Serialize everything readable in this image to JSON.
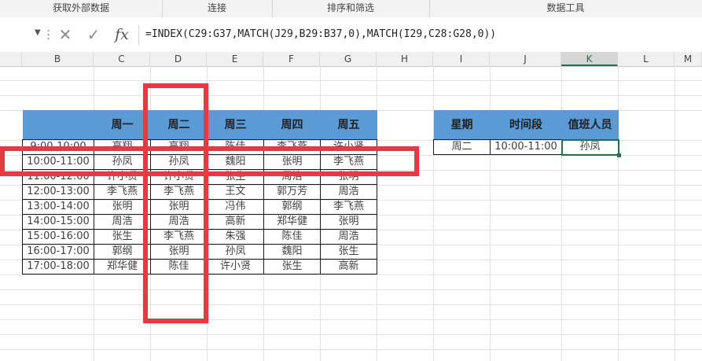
{
  "ribbon": {
    "groups": [
      "获取外部数据",
      "连接",
      "排序和筛选",
      "数据工具"
    ]
  },
  "formula_bar": {
    "cancel_icon": "✕",
    "enter_icon": "✓",
    "fx_label": "fx",
    "formula": "=INDEX(C29:G37,MATCH(J29,B29:B37,0),MATCH(I29,C28:G28,0))"
  },
  "columns": [
    "B",
    "C",
    "D",
    "E",
    "F",
    "G",
    "H",
    "I",
    "J",
    "K",
    "L",
    "M"
  ],
  "schedule": {
    "headers": [
      "",
      "周一",
      "周二",
      "周三",
      "周四",
      "周五"
    ],
    "rows": [
      [
        "9:00-10:00",
        "高翔",
        "高翔",
        "陈佳",
        "李飞燕",
        "许小贤"
      ],
      [
        "10:00-11:00",
        "孙凤",
        "孙凤",
        "魏阳",
        "张明",
        "李飞燕"
      ],
      [
        "11:00-12:00",
        "许小贤",
        "许小贤",
        "张生",
        "周浩",
        "张明"
      ],
      [
        "12:00-13:00",
        "李飞燕",
        "李飞燕",
        "王文",
        "郭万芳",
        "周浩"
      ],
      [
        "13:00-14:00",
        "张明",
        "张明",
        "冯伟",
        "郭纲",
        "李飞燕"
      ],
      [
        "14:00-15:00",
        "周浩",
        "周浩",
        "高新",
        "郑华健",
        "张明"
      ],
      [
        "15:00-16:00",
        "张生",
        "李飞燕",
        "朱强",
        "陈佳",
        "周浩"
      ],
      [
        "16:00-17:00",
        "郭纲",
        "张明",
        "孙凤",
        "魏阳",
        "张生"
      ],
      [
        "17:00-18:00",
        "郑华健",
        "陈佳",
        "许小贤",
        "张生",
        "高新"
      ]
    ]
  },
  "lookup": {
    "headers": [
      "星期",
      "时间段",
      "值班人员"
    ],
    "row": [
      "周二",
      "10:00-11:00",
      "孙凤"
    ]
  },
  "colors": {
    "header_fill": "#5b9bd5",
    "highlight": "#e8393e",
    "selection": "#217346"
  }
}
